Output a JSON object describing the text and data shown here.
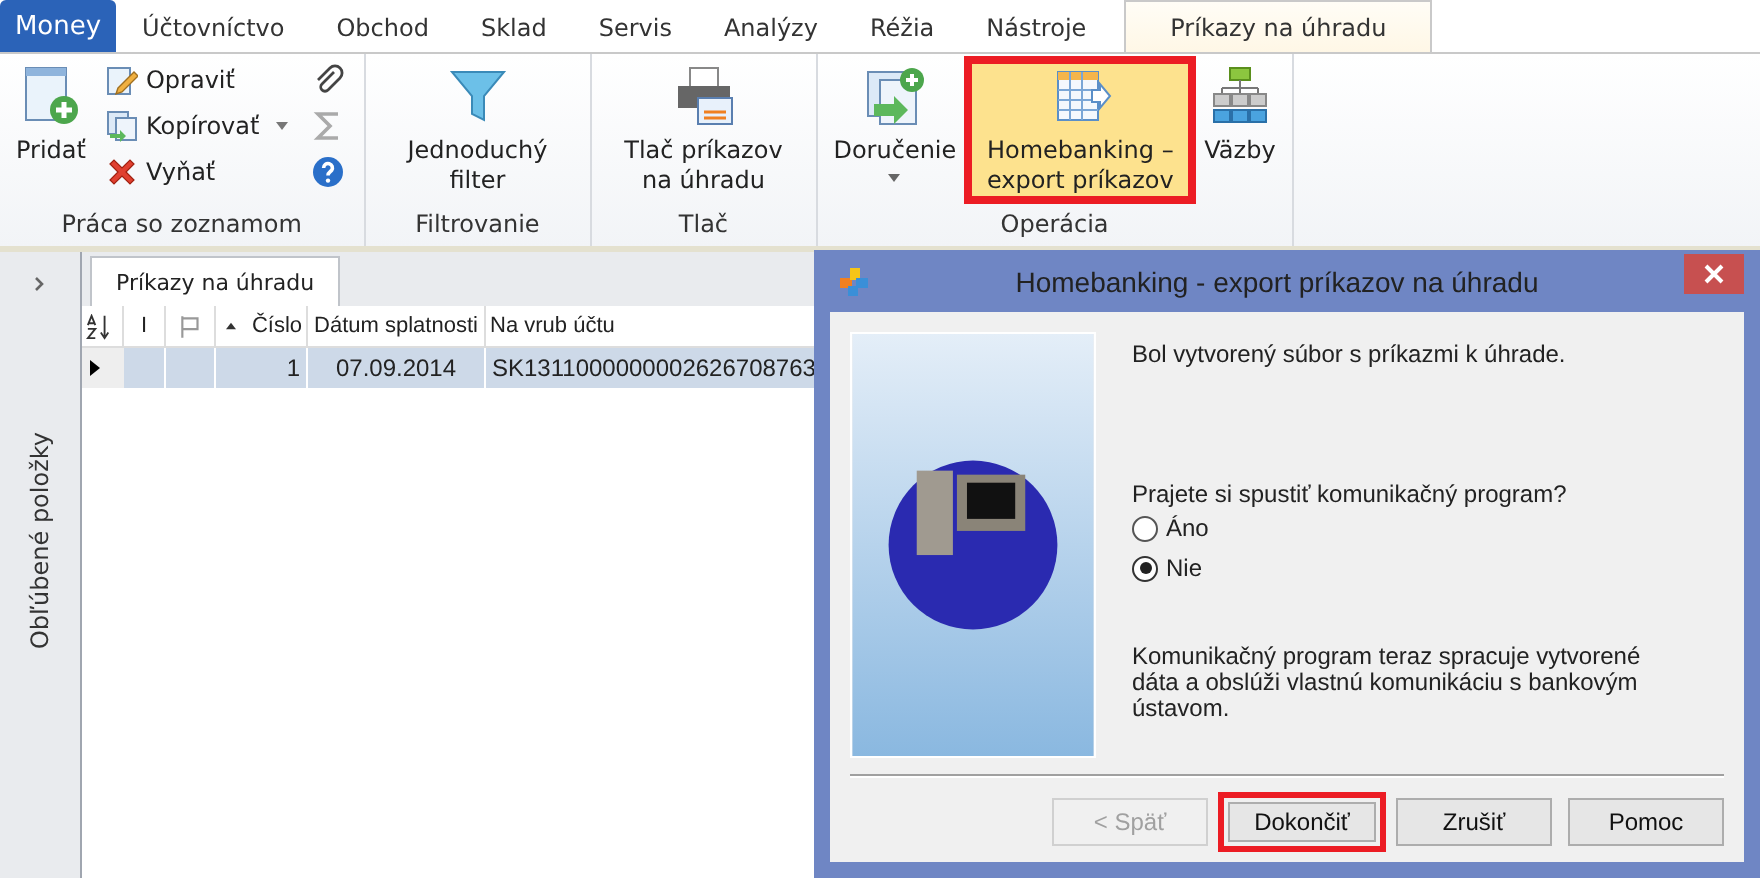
{
  "tabs": [
    {
      "label": "Money",
      "kind": "app",
      "selected": false
    },
    {
      "label": "Účtovníctvo",
      "kind": "tab",
      "selected": false
    },
    {
      "label": "Obchod",
      "kind": "tab",
      "selected": false
    },
    {
      "label": "Sklad",
      "kind": "tab",
      "selected": false
    },
    {
      "label": "Servis",
      "kind": "tab",
      "selected": false
    },
    {
      "label": "Analýzy",
      "kind": "tab",
      "selected": false
    },
    {
      "label": "Réžia",
      "kind": "tab",
      "selected": false
    },
    {
      "label": "Nástroje",
      "kind": "tab",
      "selected": false
    },
    {
      "label": "Príkazy na úhradu",
      "kind": "tab",
      "selected": true
    }
  ],
  "ribbon": {
    "groups": [
      {
        "label": "Práca so zoznamom",
        "large": [
          {
            "label": "Pridať",
            "highlighted": false,
            "caret": false
          }
        ],
        "small": [
          {
            "label": "Opraviť",
            "caret": false
          },
          {
            "label": "Kopírovať",
            "caret": true
          },
          {
            "label": "Vyňať",
            "caret": false
          }
        ]
      },
      {
        "label": "Filtrovanie",
        "large": [
          {
            "label": "Jednoduchý filter",
            "highlighted": false,
            "caret": false
          }
        ]
      },
      {
        "label": "Tlač",
        "large": [
          {
            "label": "Tlač príkazov na úhradu",
            "highlighted": false,
            "caret": false
          }
        ]
      },
      {
        "label": "Operácia",
        "large": [
          {
            "label": "Doručenie",
            "highlighted": false,
            "caret": true
          },
          {
            "label": "Homebanking – export príkazov",
            "highlighted": true,
            "caret": false
          },
          {
            "label": "Väzby",
            "highlighted": false,
            "caret": false
          }
        ]
      }
    ]
  },
  "sidebar": {
    "label": "Obľúbené položky"
  },
  "document_tab": {
    "label": "Príkazy na úhradu"
  },
  "table": {
    "columns": [
      {
        "kind": "sort-icon"
      },
      {
        "kind": "text",
        "label": "I"
      },
      {
        "kind": "flag-icon"
      },
      {
        "kind": "sorted",
        "label": "Číslo"
      },
      {
        "kind": "text",
        "label": "Dátum splatnosti"
      },
      {
        "kind": "text",
        "label": "Na vrub účtu"
      }
    ],
    "rows": [
      {
        "selected": true,
        "cells": [
          "",
          "",
          "",
          "1",
          "07.09.2014",
          "SK1311000000002626708763"
        ]
      }
    ]
  },
  "dialog": {
    "title": "Homebanking - export príkazov na úhradu",
    "message": "Bol vytvorený súbor s príkazmi k úhrade.",
    "question": "Prajete si spustiť komunikačný program?",
    "options": [
      {
        "label": "Áno",
        "selected": false
      },
      {
        "label": "Nie",
        "selected": true
      }
    ],
    "note": "Komunikačný program  teraz spracuje  vytvorené dáta a obslúži vlastnú komunikáciu s bankovým ústavom.",
    "buttons": [
      {
        "label": "< Späť",
        "disabled": true,
        "highlighted": false
      },
      {
        "label": "Dokončiť",
        "disabled": false,
        "highlighted": true
      },
      {
        "label": "Zrušiť",
        "disabled": false,
        "highlighted": false
      },
      {
        "label": "Pomoc",
        "disabled": false,
        "highlighted": false
      }
    ]
  }
}
